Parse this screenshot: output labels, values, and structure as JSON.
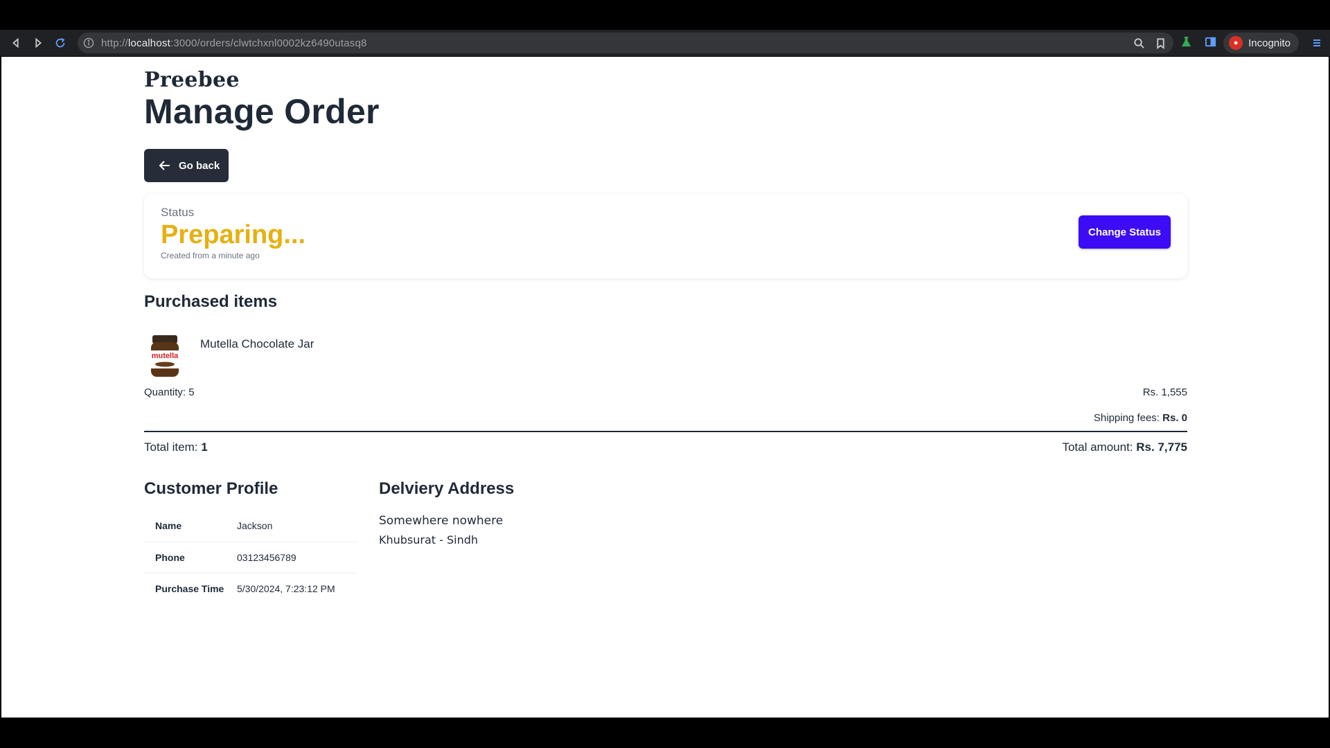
{
  "browser": {
    "url_scheme": "http://",
    "url_host": "localhost",
    "url_path": ":3000/orders/clwtchxnl0002kz6490utasq8",
    "profile_label": "Incognito"
  },
  "page": {
    "brand": "Preebee",
    "title": "Manage Order",
    "go_back_label": "Go back"
  },
  "status": {
    "label": "Status",
    "value": "Preparing...",
    "created": "Created from a minute ago",
    "change_label": "Change Status",
    "value_color": "#e6b012",
    "button_color": "#3d0cf5"
  },
  "purchased": {
    "heading": "Purchased items",
    "items": [
      {
        "name": "Mutella Chocolate Jar",
        "jar_label": "mutella",
        "quantity_label": "Quantity:",
        "quantity": "5",
        "price": "Rs. 1,555"
      }
    ],
    "shipping_label": "Shipping fees:",
    "shipping_value": "Rs. 0",
    "total_item_label": "Total item:",
    "total_item_value": "1",
    "total_amount_label": "Total amount:",
    "total_amount_value": "Rs. 7,775"
  },
  "customer": {
    "heading": "Customer Profile",
    "rows": [
      {
        "key": "Name",
        "value": "Jackson"
      },
      {
        "key": "Phone",
        "value": "03123456789"
      },
      {
        "key": "Purchase Time",
        "value": "5/30/2024, 7:23:12 PM"
      }
    ]
  },
  "address": {
    "heading": "Delviery Address",
    "line1": "Somewhere nowhere",
    "line2": "Khubsurat - Sindh"
  },
  "icons": {
    "back": "arrow-left-icon",
    "forward": "arrow-right-icon",
    "reload": "reload-icon",
    "info": "info-icon",
    "zoom": "magnifier-icon",
    "bookmark": "bookmark-icon",
    "lab": "flask-icon",
    "panel": "side-panel-icon",
    "incognito": "incognito-icon",
    "menu": "menu-icon"
  }
}
